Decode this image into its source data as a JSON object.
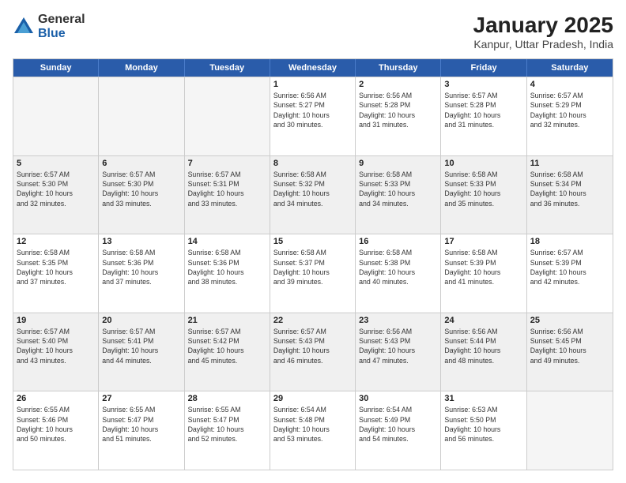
{
  "header": {
    "logo_general": "General",
    "logo_blue": "Blue",
    "month_year": "January 2025",
    "location": "Kanpur, Uttar Pradesh, India"
  },
  "days_of_week": [
    "Sunday",
    "Monday",
    "Tuesday",
    "Wednesday",
    "Thursday",
    "Friday",
    "Saturday"
  ],
  "weeks": [
    [
      {
        "day": "",
        "info": ""
      },
      {
        "day": "",
        "info": ""
      },
      {
        "day": "",
        "info": ""
      },
      {
        "day": "1",
        "info": "Sunrise: 6:56 AM\nSunset: 5:27 PM\nDaylight: 10 hours\nand 30 minutes."
      },
      {
        "day": "2",
        "info": "Sunrise: 6:56 AM\nSunset: 5:28 PM\nDaylight: 10 hours\nand 31 minutes."
      },
      {
        "day": "3",
        "info": "Sunrise: 6:57 AM\nSunset: 5:28 PM\nDaylight: 10 hours\nand 31 minutes."
      },
      {
        "day": "4",
        "info": "Sunrise: 6:57 AM\nSunset: 5:29 PM\nDaylight: 10 hours\nand 32 minutes."
      }
    ],
    [
      {
        "day": "5",
        "info": "Sunrise: 6:57 AM\nSunset: 5:30 PM\nDaylight: 10 hours\nand 32 minutes."
      },
      {
        "day": "6",
        "info": "Sunrise: 6:57 AM\nSunset: 5:30 PM\nDaylight: 10 hours\nand 33 minutes."
      },
      {
        "day": "7",
        "info": "Sunrise: 6:57 AM\nSunset: 5:31 PM\nDaylight: 10 hours\nand 33 minutes."
      },
      {
        "day": "8",
        "info": "Sunrise: 6:58 AM\nSunset: 5:32 PM\nDaylight: 10 hours\nand 34 minutes."
      },
      {
        "day": "9",
        "info": "Sunrise: 6:58 AM\nSunset: 5:33 PM\nDaylight: 10 hours\nand 34 minutes."
      },
      {
        "day": "10",
        "info": "Sunrise: 6:58 AM\nSunset: 5:33 PM\nDaylight: 10 hours\nand 35 minutes."
      },
      {
        "day": "11",
        "info": "Sunrise: 6:58 AM\nSunset: 5:34 PM\nDaylight: 10 hours\nand 36 minutes."
      }
    ],
    [
      {
        "day": "12",
        "info": "Sunrise: 6:58 AM\nSunset: 5:35 PM\nDaylight: 10 hours\nand 37 minutes."
      },
      {
        "day": "13",
        "info": "Sunrise: 6:58 AM\nSunset: 5:36 PM\nDaylight: 10 hours\nand 37 minutes."
      },
      {
        "day": "14",
        "info": "Sunrise: 6:58 AM\nSunset: 5:36 PM\nDaylight: 10 hours\nand 38 minutes."
      },
      {
        "day": "15",
        "info": "Sunrise: 6:58 AM\nSunset: 5:37 PM\nDaylight: 10 hours\nand 39 minutes."
      },
      {
        "day": "16",
        "info": "Sunrise: 6:58 AM\nSunset: 5:38 PM\nDaylight: 10 hours\nand 40 minutes."
      },
      {
        "day": "17",
        "info": "Sunrise: 6:58 AM\nSunset: 5:39 PM\nDaylight: 10 hours\nand 41 minutes."
      },
      {
        "day": "18",
        "info": "Sunrise: 6:57 AM\nSunset: 5:39 PM\nDaylight: 10 hours\nand 42 minutes."
      }
    ],
    [
      {
        "day": "19",
        "info": "Sunrise: 6:57 AM\nSunset: 5:40 PM\nDaylight: 10 hours\nand 43 minutes."
      },
      {
        "day": "20",
        "info": "Sunrise: 6:57 AM\nSunset: 5:41 PM\nDaylight: 10 hours\nand 44 minutes."
      },
      {
        "day": "21",
        "info": "Sunrise: 6:57 AM\nSunset: 5:42 PM\nDaylight: 10 hours\nand 45 minutes."
      },
      {
        "day": "22",
        "info": "Sunrise: 6:57 AM\nSunset: 5:43 PM\nDaylight: 10 hours\nand 46 minutes."
      },
      {
        "day": "23",
        "info": "Sunrise: 6:56 AM\nSunset: 5:43 PM\nDaylight: 10 hours\nand 47 minutes."
      },
      {
        "day": "24",
        "info": "Sunrise: 6:56 AM\nSunset: 5:44 PM\nDaylight: 10 hours\nand 48 minutes."
      },
      {
        "day": "25",
        "info": "Sunrise: 6:56 AM\nSunset: 5:45 PM\nDaylight: 10 hours\nand 49 minutes."
      }
    ],
    [
      {
        "day": "26",
        "info": "Sunrise: 6:55 AM\nSunset: 5:46 PM\nDaylight: 10 hours\nand 50 minutes."
      },
      {
        "day": "27",
        "info": "Sunrise: 6:55 AM\nSunset: 5:47 PM\nDaylight: 10 hours\nand 51 minutes."
      },
      {
        "day": "28",
        "info": "Sunrise: 6:55 AM\nSunset: 5:47 PM\nDaylight: 10 hours\nand 52 minutes."
      },
      {
        "day": "29",
        "info": "Sunrise: 6:54 AM\nSunset: 5:48 PM\nDaylight: 10 hours\nand 53 minutes."
      },
      {
        "day": "30",
        "info": "Sunrise: 6:54 AM\nSunset: 5:49 PM\nDaylight: 10 hours\nand 54 minutes."
      },
      {
        "day": "31",
        "info": "Sunrise: 6:53 AM\nSunset: 5:50 PM\nDaylight: 10 hours\nand 56 minutes."
      },
      {
        "day": "",
        "info": ""
      }
    ]
  ]
}
